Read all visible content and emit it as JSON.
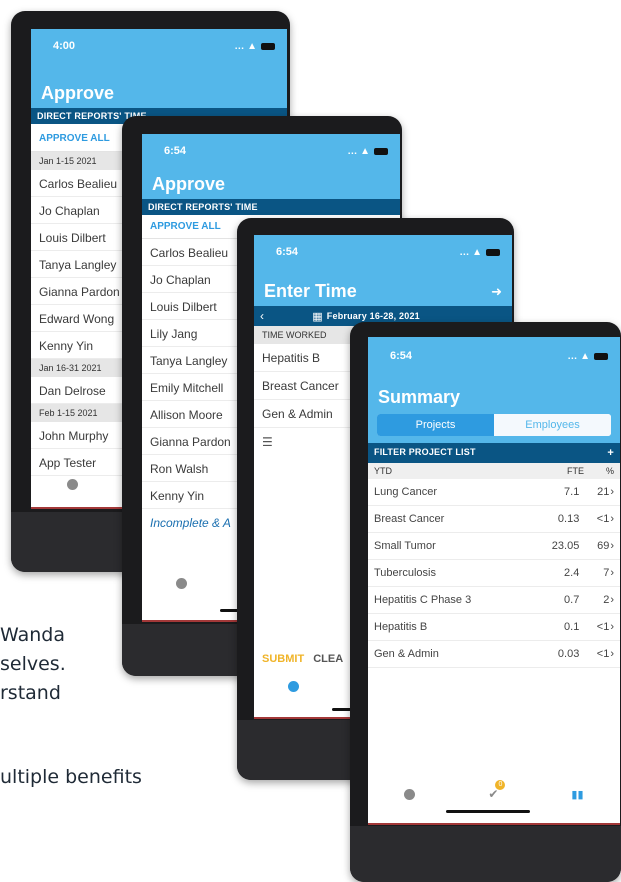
{
  "background_text": [
    "Wanda",
    "selves.",
    "rstand",
    "ultiple benefits"
  ],
  "phone1": {
    "time": "4:00",
    "title": "Approve",
    "bar": "DIRECT REPORTS' TIME",
    "approve_all": "APPROVE ALL",
    "items": [
      {
        "type": "group",
        "text": "Jan 1-15 2021"
      },
      {
        "type": "row",
        "text": "Carlos Bealieu"
      },
      {
        "type": "row",
        "text": "Jo Chaplan"
      },
      {
        "type": "row",
        "text": "Louis Dilbert"
      },
      {
        "type": "row",
        "text": "Tanya Langley"
      },
      {
        "type": "row",
        "text": "Gianna Pardon"
      },
      {
        "type": "row",
        "text": "Edward Wong"
      },
      {
        "type": "row",
        "text": "Kenny Yin"
      },
      {
        "type": "group",
        "text": "Jan 16-31 2021"
      },
      {
        "type": "row",
        "text": "Dan Delrose"
      },
      {
        "type": "group",
        "text": "Feb 1-15 2021"
      },
      {
        "type": "row",
        "text": "John Murphy"
      },
      {
        "type": "row",
        "text": "App Tester"
      }
    ]
  },
  "phone2": {
    "time": "6:54",
    "title": "Approve",
    "bar": "DIRECT REPORTS' TIME",
    "approve_all": "APPROVE ALL",
    "rows": [
      "Carlos Bealieu",
      "Jo Chaplan",
      "Louis Dilbert",
      "Lily Jang",
      "Tanya Langley",
      "Emily Mitchell",
      "Allison Moore",
      "Gianna Pardon",
      "Ron Walsh",
      "Kenny Yin"
    ],
    "incomplete": "Incomplete & A"
  },
  "phone3": {
    "time": "6:54",
    "title": "Enter Time",
    "date_range": "February 16-28, 2021",
    "section": "TIME WORKED",
    "rows": [
      "Hepatitis B",
      "Breast Cancer",
      "Gen & Admin"
    ],
    "submit": "SUBMIT",
    "clear": "CLEA"
  },
  "phone4": {
    "time": "6:54",
    "title": "Summary",
    "tabs": [
      "Projects",
      "Employees"
    ],
    "filter": "FILTER PROJECT LIST",
    "columns": [
      "YTD",
      "FTE",
      "%"
    ],
    "rows": [
      {
        "name": "Lung Cancer",
        "fte": "7.1",
        "pct": "21"
      },
      {
        "name": "Breast Cancer",
        "fte": "0.13",
        "pct": "<1"
      },
      {
        "name": "Small Tumor",
        "fte": "23.05",
        "pct": "69"
      },
      {
        "name": "Tuberculosis",
        "fte": "2.4",
        "pct": "7"
      },
      {
        "name": "Hepatitis C Phase 3",
        "fte": "0.7",
        "pct": "2"
      },
      {
        "name": "Hepatitis B",
        "fte": "0.1",
        "pct": "<1"
      },
      {
        "name": "Gen & Admin",
        "fte": "0.03",
        "pct": "<1"
      }
    ],
    "badge_count": "0"
  },
  "colors": {
    "header": "#54b7ea",
    "bar": "#0a5584",
    "accent": "#2e9be0",
    "submit": "#f0b429"
  }
}
